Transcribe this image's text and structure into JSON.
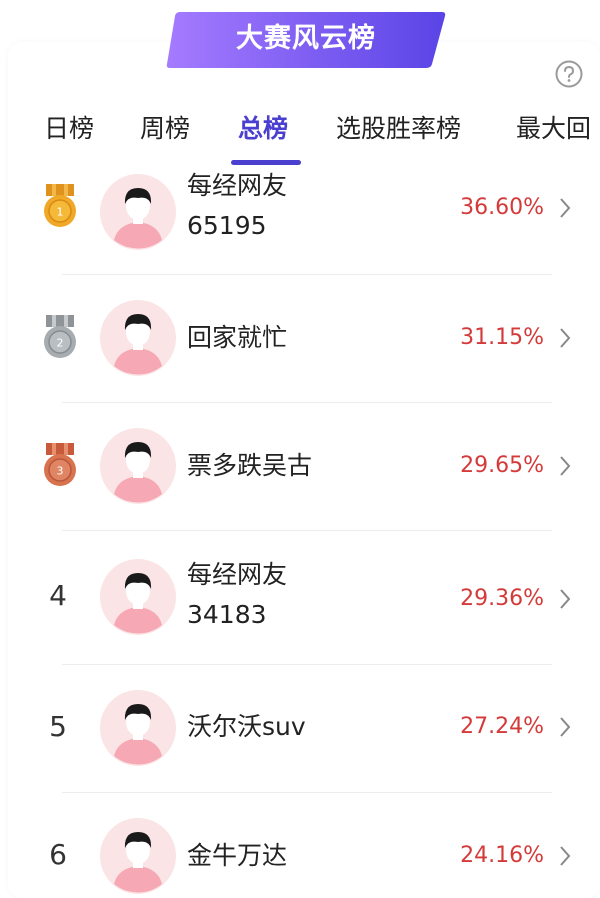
{
  "banner": {
    "title": "大赛风云榜"
  },
  "tabs": [
    {
      "label": "日榜",
      "active": false
    },
    {
      "label": "周榜",
      "active": false
    },
    {
      "label": "总榜",
      "active": true
    },
    {
      "label": "选股胜率榜",
      "active": false
    },
    {
      "label": "最大回",
      "active": false
    }
  ],
  "colors": {
    "accent": "#4b3fd0",
    "rate": "#d43a3a",
    "banner_start": "#9b6bff",
    "banner_end": "#5b45e8"
  },
  "ranking": [
    {
      "rank": "1",
      "medal": "gold-medal-icon",
      "name": "每经网友",
      "name2": "65195",
      "rate": "36.60%"
    },
    {
      "rank": "2",
      "medal": "silver-medal-icon",
      "name": "回家就忙",
      "name2": "",
      "rate": "31.15%"
    },
    {
      "rank": "3",
      "medal": "bronze-medal-icon",
      "name": "票多跌吴古",
      "name2": "",
      "rate": "29.65%"
    },
    {
      "rank": "4",
      "medal": "",
      "name": "每经网友",
      "name2": "34183",
      "rate": "29.36%"
    },
    {
      "rank": "5",
      "medal": "",
      "name": "沃尔沃suv",
      "name2": "",
      "rate": "27.24%"
    },
    {
      "rank": "6",
      "medal": "",
      "name": "金牛万达",
      "name2": "",
      "rate": "24.16%"
    }
  ]
}
